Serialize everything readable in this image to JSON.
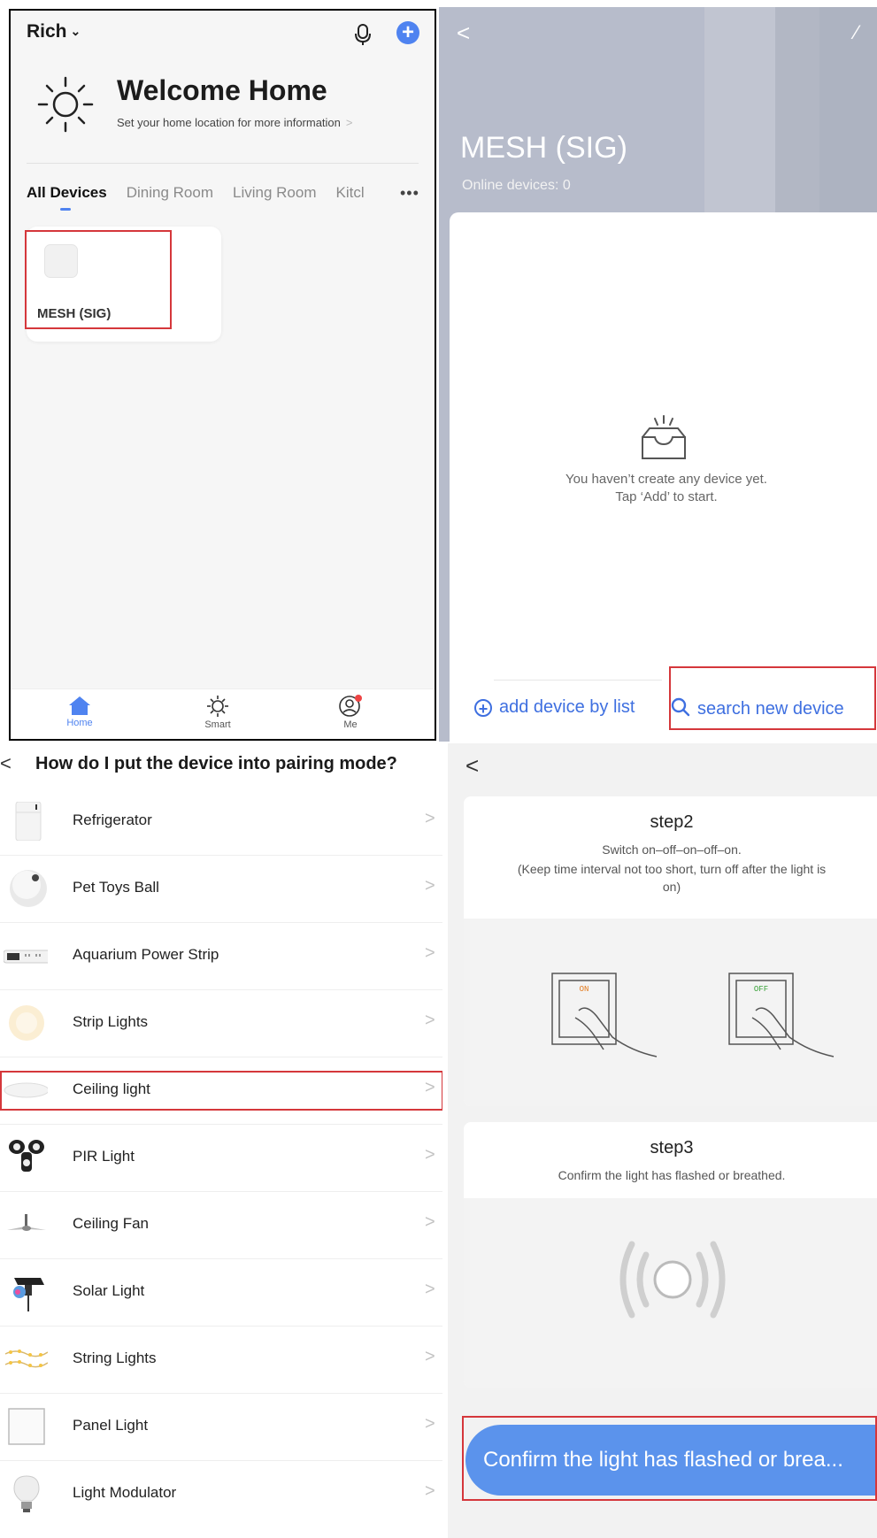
{
  "home": {
    "user": "Rich",
    "welcome_title": "Welcome Home",
    "welcome_subtitle": "Set your home location for more information",
    "tabs": [
      "All Devices",
      "Dining Room",
      "Living Room",
      "Kitcl"
    ],
    "more": "•••",
    "device_name": "MESH (SIG)",
    "nav": [
      {
        "label": "Home",
        "icon": "home-icon"
      },
      {
        "label": "Smart",
        "icon": "sun-icon"
      },
      {
        "label": "Me",
        "icon": "profile-icon"
      }
    ],
    "accent": "#4f83f0"
  },
  "mesh": {
    "title": "MESH (SIG)",
    "online": "Online devices: 0",
    "empty_line1": "You haven’t create any device yet.",
    "empty_line2": "Tap ‘Add’ to start.",
    "add_by_list": "add device by list",
    "search_new": "search new device"
  },
  "pairing": {
    "title": "How do I put the device into pairing mode?",
    "items": [
      {
        "label": "Refrigerator",
        "icon": "refrigerator-icon"
      },
      {
        "label": "Pet Toys Ball",
        "icon": "ball-icon"
      },
      {
        "label": "Aquarium Power Strip",
        "icon": "power-strip-icon"
      },
      {
        "label": "Strip Lights",
        "icon": "strip-lights-icon"
      },
      {
        "label": "Ceiling light",
        "icon": "ceiling-light-icon"
      },
      {
        "label": "PIR Light",
        "icon": "pir-light-icon"
      },
      {
        "label": "Ceiling Fan",
        "icon": "ceiling-fan-icon"
      },
      {
        "label": "Solar Light",
        "icon": "solar-light-icon"
      },
      {
        "label": "String Lights",
        "icon": "string-lights-icon"
      },
      {
        "label": "Panel Light",
        "icon": "panel-light-icon"
      },
      {
        "label": "Light Modulator",
        "icon": "bulb-icon"
      }
    ]
  },
  "steps": {
    "step2_title": "step2",
    "step2_line1": "Switch on–off–on–off–on.",
    "step2_line2": "(Keep time interval not too short, turn off after the light is",
    "step2_line3": "on)",
    "on_label": "ON",
    "off_label": "OFF",
    "step3_title": "step3",
    "step3_line1": "Confirm the light has flashed or breathed.",
    "confirm_button": "Confirm the light has flashed or brea..."
  },
  "highlight_color": "#d5373b"
}
